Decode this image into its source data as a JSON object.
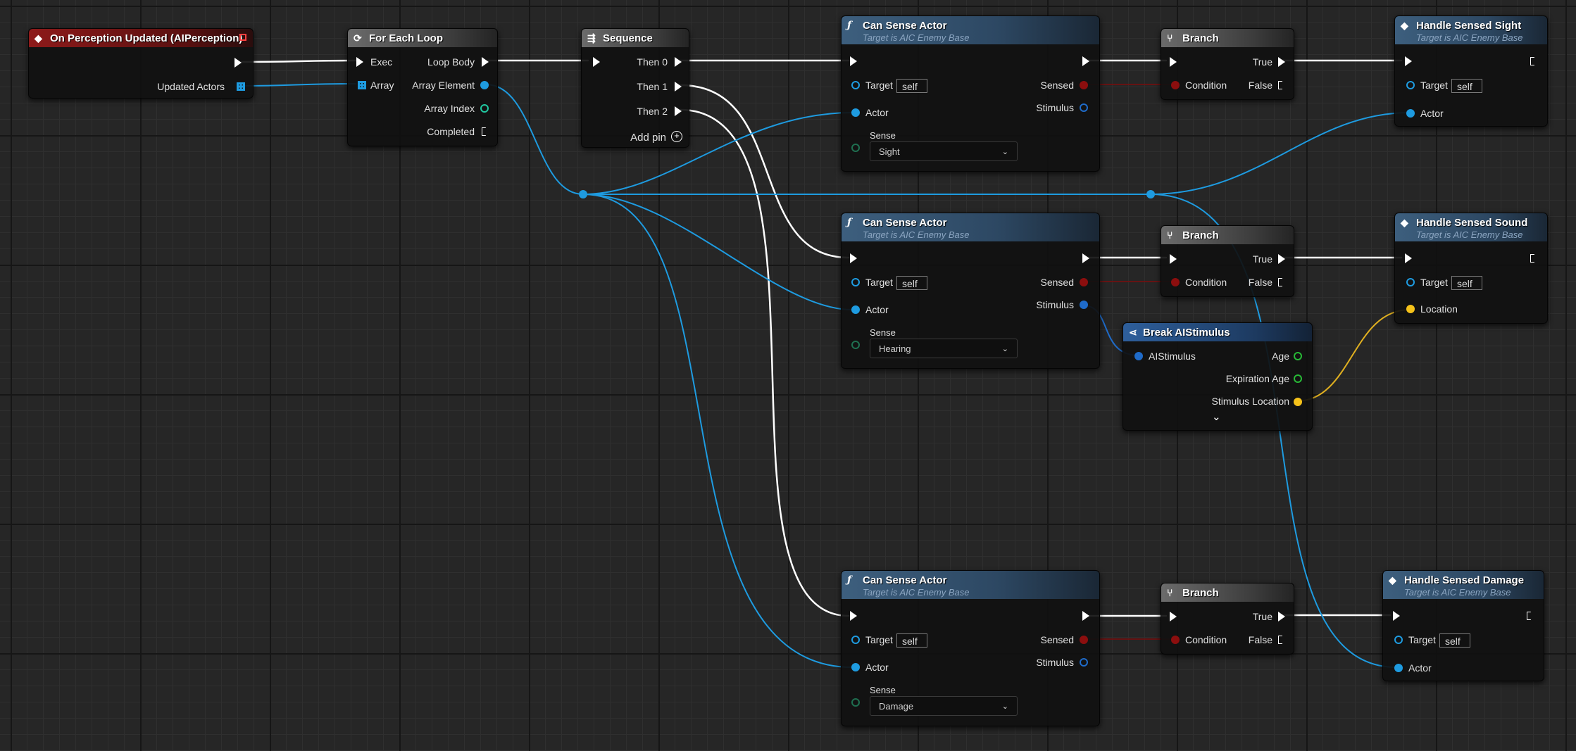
{
  "colors": {
    "object_pin": "#1e9be0",
    "bool_pin": "#8c0e0e",
    "struct_pin": "#1f6bc9",
    "float_pin": "#27b936",
    "vector_pin": "#f5c21a",
    "exec_wire": "#ffffff"
  },
  "event_node": {
    "title": "On Perception Updated (AIPerception)",
    "icon": "event-diamond-icon",
    "out_pin": "Updated Actors"
  },
  "foreach_node": {
    "title": "For Each Loop",
    "icon": "loop-icon",
    "inputs": [
      "Exec",
      "Array"
    ],
    "outputs": [
      "Loop Body",
      "Array Element",
      "Array Index",
      "Completed"
    ]
  },
  "sequence_node": {
    "title": "Sequence",
    "icon": "sequence-icon",
    "outputs": [
      "Then 0",
      "Then 1",
      "Then 2"
    ],
    "add_pin": "Add pin"
  },
  "can_sense": [
    {
      "title": "Can Sense Actor",
      "subtitle": "Target is AIC Enemy Base",
      "target": "Target",
      "target_value": "self",
      "actor": "Actor",
      "sense_label": "Sense",
      "sense_value": "Sight",
      "sensed": "Sensed",
      "stimulus": "Stimulus"
    },
    {
      "title": "Can Sense Actor",
      "subtitle": "Target is AIC Enemy Base",
      "target": "Target",
      "target_value": "self",
      "actor": "Actor",
      "sense_label": "Sense",
      "sense_value": "Hearing",
      "sensed": "Sensed",
      "stimulus": "Stimulus"
    },
    {
      "title": "Can Sense Actor",
      "subtitle": "Target is AIC Enemy Base",
      "target": "Target",
      "target_value": "self",
      "actor": "Actor",
      "sense_label": "Sense",
      "sense_value": "Damage",
      "sensed": "Sensed",
      "stimulus": "Stimulus"
    }
  ],
  "branches": [
    {
      "title": "Branch",
      "condition": "Condition",
      "true": "True",
      "false": "False"
    },
    {
      "title": "Branch",
      "condition": "Condition",
      "true": "True",
      "false": "False"
    },
    {
      "title": "Branch",
      "condition": "Condition",
      "true": "True",
      "false": "False"
    }
  ],
  "handlers": [
    {
      "title": "Handle Sensed Sight",
      "subtitle": "Target is AIC Enemy Base",
      "target": "Target",
      "target_value": "self",
      "param": "Actor"
    },
    {
      "title": "Handle Sensed Sound",
      "subtitle": "Target is AIC Enemy Base",
      "target": "Target",
      "target_value": "self",
      "param": "Location"
    },
    {
      "title": "Handle Sensed Damage",
      "subtitle": "Target is AIC Enemy Base",
      "target": "Target",
      "target_value": "self",
      "param": "Actor"
    }
  ],
  "break_node": {
    "title": "Break AIStimulus",
    "icon": "break-struct-icon",
    "input": "AIStimulus",
    "outputs": [
      "Age",
      "Expiration Age",
      "Stimulus Location"
    ],
    "expand_icon": "chevron-down-icon"
  }
}
